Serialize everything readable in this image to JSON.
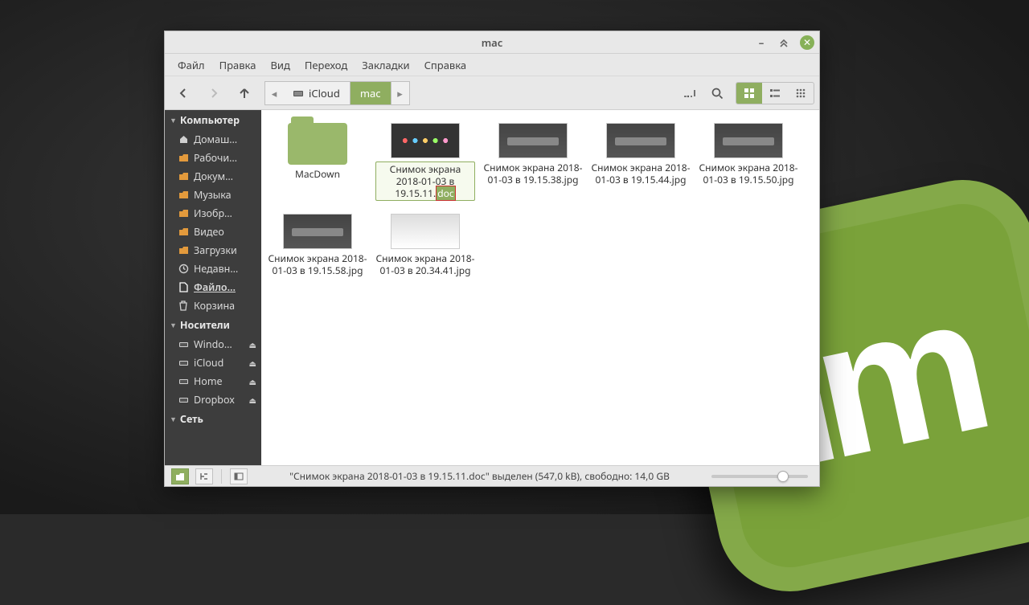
{
  "window": {
    "title": "mac"
  },
  "menu": [
    "Файл",
    "Правка",
    "Вид",
    "Переход",
    "Закладки",
    "Справка"
  ],
  "path": {
    "segments": [
      {
        "label": "iCloud",
        "active": false
      },
      {
        "label": "mac",
        "active": true
      }
    ]
  },
  "sidebar": {
    "sections": [
      {
        "title": "Компьютер",
        "items": [
          {
            "label": "Домаш…",
            "icon": "home"
          },
          {
            "label": "Рабочи…",
            "icon": "folder"
          },
          {
            "label": "Докум…",
            "icon": "folder"
          },
          {
            "label": "Музыка",
            "icon": "folder"
          },
          {
            "label": "Изобр…",
            "icon": "folder"
          },
          {
            "label": "Видео",
            "icon": "folder"
          },
          {
            "label": "Загрузки",
            "icon": "folder"
          },
          {
            "label": "Недавн…",
            "icon": "clock"
          },
          {
            "label": "Файло…",
            "icon": "file",
            "selected": true
          },
          {
            "label": "Корзина",
            "icon": "trash"
          }
        ]
      },
      {
        "title": "Носители",
        "items": [
          {
            "label": "Windo…",
            "icon": "disk",
            "eject": true
          },
          {
            "label": "iCloud",
            "icon": "disk",
            "eject": true
          },
          {
            "label": "Home",
            "icon": "disk",
            "eject": true
          },
          {
            "label": "Dropbox",
            "icon": "disk",
            "eject": true
          }
        ]
      },
      {
        "title": "Сеть",
        "items": []
      }
    ]
  },
  "files": [
    {
      "name": "MacDown",
      "type": "folder"
    },
    {
      "name": "Снимок экрана 2018-01-03 в 19.15.11.",
      "ext": "doc",
      "type": "dots",
      "selected": true
    },
    {
      "name": "Снимок экрана 2018-01-03 в 19.15.38.jpg",
      "type": "bar"
    },
    {
      "name": "Снимок экрана 2018-01-03 в 19.15.44.jpg",
      "type": "bar"
    },
    {
      "name": "Снимок экрана 2018-01-03 в 19.15.50.jpg",
      "type": "bar"
    },
    {
      "name": "Снимок экрана 2018-01-03 в 19.15.58.jpg",
      "type": "bar"
    },
    {
      "name": "Снимок экрана 2018-01-03 в 20.34.41.jpg",
      "type": "light"
    }
  ],
  "status": {
    "text": "\"Снимок экрана 2018-01-03 в 19.15.11.doc\" выделен (547,0 kB), свободно: 14,0 GB"
  }
}
